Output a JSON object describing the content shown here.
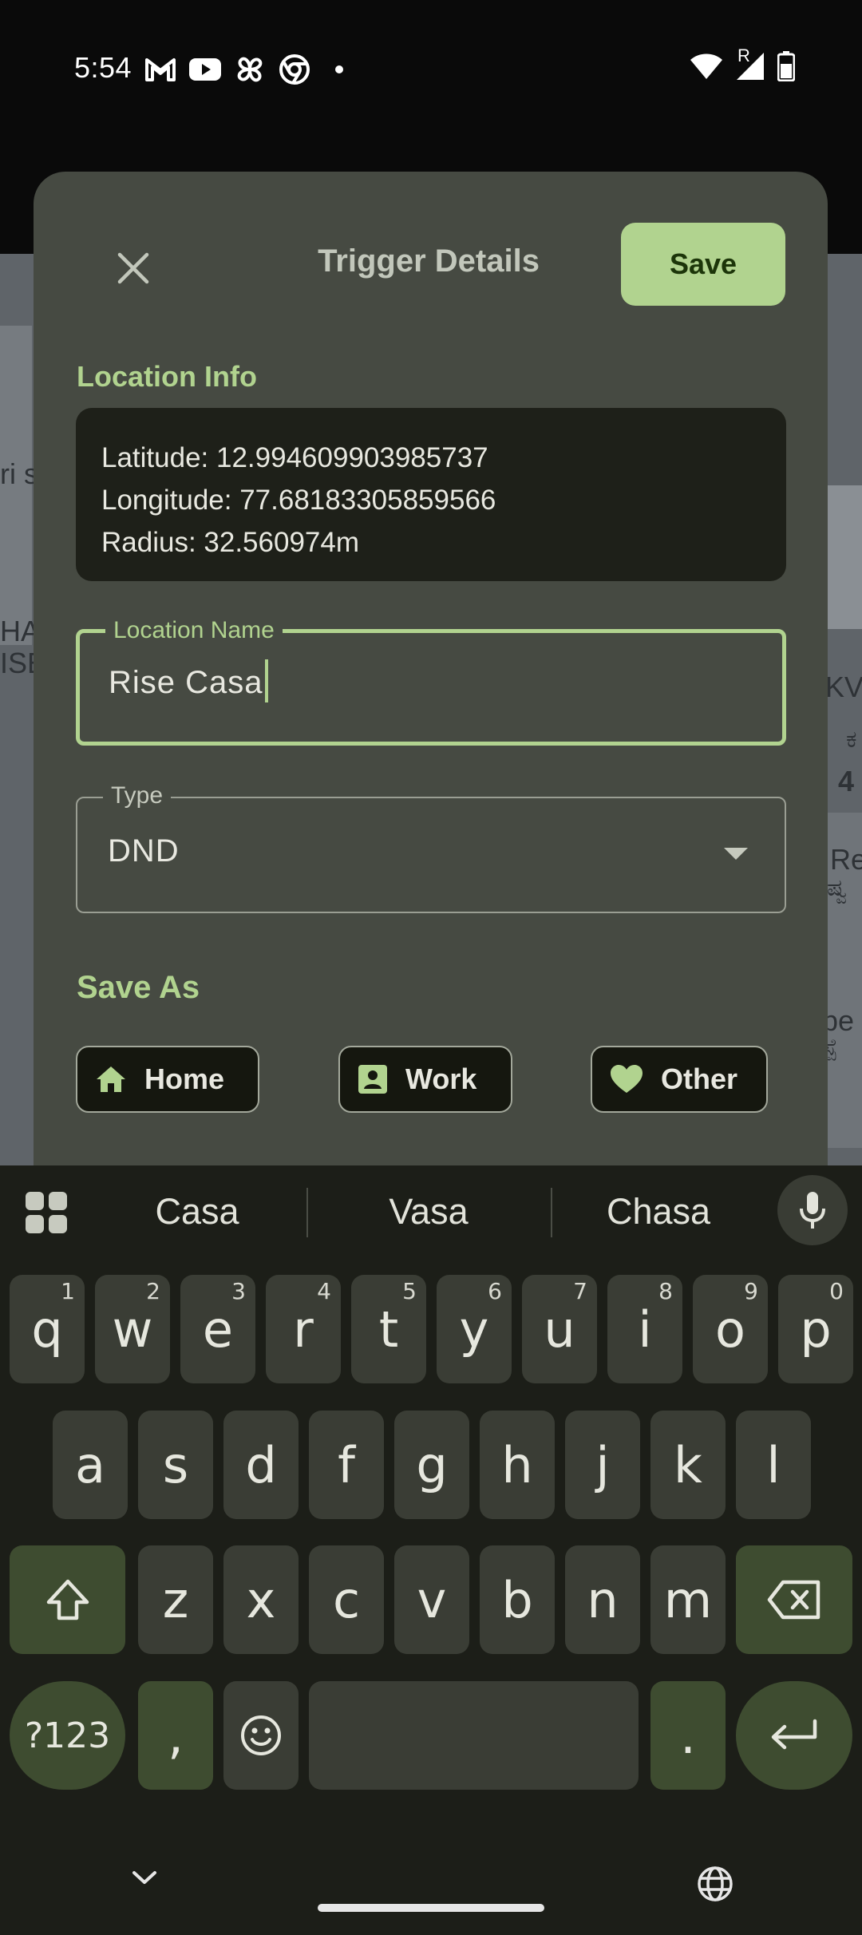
{
  "status_bar": {
    "time": "5:54",
    "left_icons": [
      "gmail-icon",
      "youtube-icon",
      "pinwheel-icon",
      "chrome-icon",
      "dot-icon"
    ],
    "right_icons": [
      "wifi-icon",
      "signal-icon",
      "battery-icon"
    ],
    "signal_badge": "R"
  },
  "map": {
    "labels": [
      "ri s",
      "HA",
      "ISE",
      "KV",
      "ಕ",
      "4",
      "Re",
      "ಷ್ವ",
      "pe",
      "ಸ್ಪೆ"
    ]
  },
  "dialog": {
    "title": "Trigger Details",
    "save_label": "Save",
    "location_info": {
      "section_label": "Location Info",
      "latitude": "Latitude: 12.994609903985737",
      "longitude": "Longitude: 77.68183305859566",
      "radius": "Radius: 32.560974m"
    },
    "location_name": {
      "label": "Location Name",
      "value": "Rise Casa"
    },
    "type": {
      "label": "Type",
      "value": "DND"
    },
    "save_as": {
      "section_label": "Save As",
      "chips": [
        {
          "label": "Home",
          "icon": "home-icon"
        },
        {
          "label": "Work",
          "icon": "badge-icon"
        },
        {
          "label": "Other",
          "icon": "heart-icon"
        }
      ]
    },
    "accent_color": "#b1d38f"
  },
  "keyboard": {
    "suggestions": [
      "Casa",
      "Vasa",
      "Chasa"
    ],
    "row1": [
      {
        "key": "q",
        "hint": "1"
      },
      {
        "key": "w",
        "hint": "2"
      },
      {
        "key": "e",
        "hint": "3"
      },
      {
        "key": "r",
        "hint": "4"
      },
      {
        "key": "t",
        "hint": "5"
      },
      {
        "key": "y",
        "hint": "6"
      },
      {
        "key": "u",
        "hint": "7"
      },
      {
        "key": "i",
        "hint": "8"
      },
      {
        "key": "o",
        "hint": "9"
      },
      {
        "key": "p",
        "hint": "0"
      }
    ],
    "row2": [
      "a",
      "s",
      "d",
      "f",
      "g",
      "h",
      "j",
      "k",
      "l"
    ],
    "row3": [
      "z",
      "x",
      "c",
      "v",
      "b",
      "n",
      "m"
    ],
    "symbols_label": "?123",
    "comma": ",",
    "period": "."
  }
}
